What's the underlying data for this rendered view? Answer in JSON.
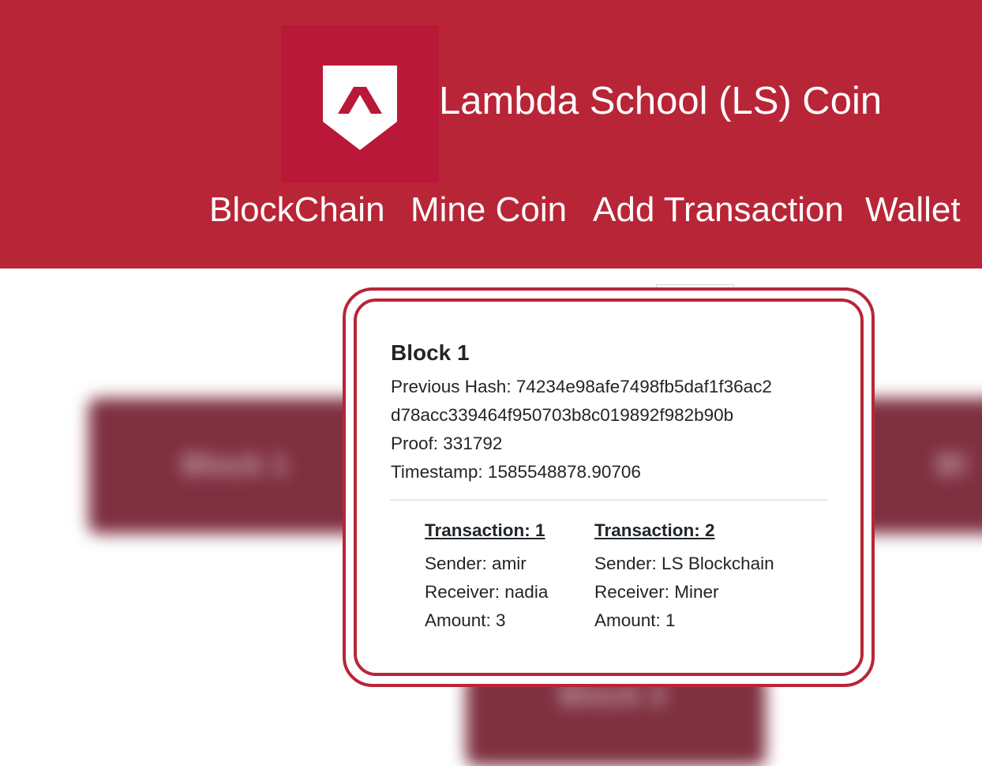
{
  "header": {
    "title": "Lambda School (LS) Coin",
    "logo": "lambda-shield-icon",
    "colors": {
      "header_bg": "#b82537",
      "logo_tile": "#b91838",
      "text": "#ffffff"
    }
  },
  "nav": {
    "blockchain": "BlockChain",
    "mine": "Mine Coin",
    "add_transaction": "Add Transaction",
    "wallet": "Wallet"
  },
  "background_cards": {
    "left_label": "Block 1",
    "right_label": "Bl",
    "bottom_label": "Block 3"
  },
  "modal": {
    "block_title": "Block 1",
    "previous_hash_line1": "Previous Hash: 74234e98afe7498fb5daf1f36ac2",
    "previous_hash_line2": "d78acc339464f950703b8c019892f982b90b",
    "proof": "Proof: 331792",
    "timestamp": "Timestamp: 1585548878.90706",
    "transactions": [
      {
        "title": "Transaction: 1",
        "sender": "Sender: amir",
        "receiver": "Receiver: nadia",
        "amount": "Amount: 3"
      },
      {
        "title": "Transaction: 2",
        "sender": "Sender: LS Blockchain",
        "receiver": "Receiver: Miner",
        "amount": "Amount: 1"
      }
    ],
    "colors": {
      "border": "#b82537"
    }
  }
}
